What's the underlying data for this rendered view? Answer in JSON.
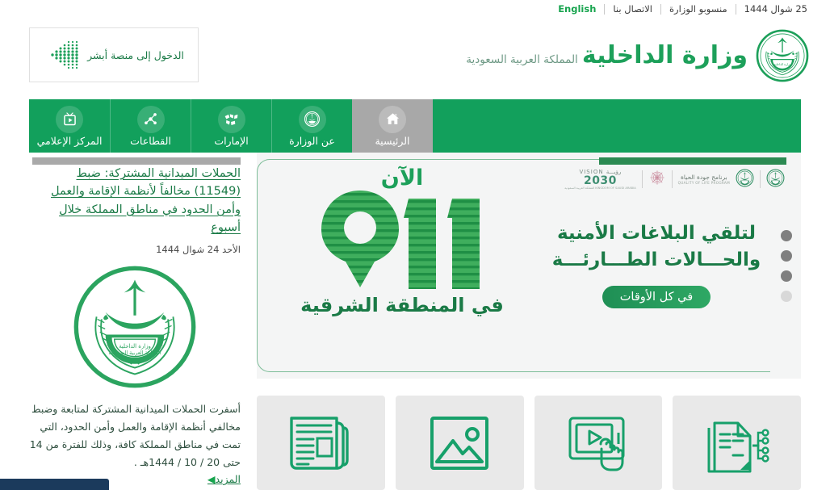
{
  "topbar": {
    "date": "25 شوال 1444",
    "links": [
      {
        "label": "منسوبو الوزارة"
      },
      {
        "label": "الاتصال بنا"
      },
      {
        "label": "English"
      }
    ]
  },
  "header": {
    "absher_button": {
      "label": "الدخول إلى منصة أبشر",
      "icon": "absher-chevron-icon"
    },
    "logo": {
      "title": "وزارة الداخلية",
      "subtitle": "المملكة العربية السعودية",
      "emblem_icon": "moi-emblem-icon"
    }
  },
  "nav": {
    "items": [
      {
        "label": "الرئيسية",
        "icon": "home-icon",
        "active": true
      },
      {
        "label": "عن الوزارة",
        "icon": "ministry-emblem-icon",
        "active": false
      },
      {
        "label": "الإمارات",
        "icon": "regions-icon",
        "active": false
      },
      {
        "label": "القطاعات",
        "icon": "sectors-network-icon",
        "active": false
      },
      {
        "label": "المركز الإعلامي",
        "icon": "media-tv-icon",
        "active": false
      }
    ],
    "active_bg": "#a8a8a8",
    "bar_bg": "#12a05c"
  },
  "news": {
    "title": "الحملات الميدانية المشتركة: ضبط (11549) مخالفاً لأنظمة الإقامة والعمل وأمن الحدود في مناطق المملكة خلال أسبوع",
    "date": "الأحد 24 شوال 1444",
    "image_icon": "moi-emblem-icon",
    "body": "أسفرت الحملات الميدانية المشتركة لمتابعة وضبط مخالفي أنظمة الإقامة والعمل وأمن الحدود، التي تمت في مناطق المملكة كافة، وذلك للفترة من 14 حتى 20 / 10 / 1444هـ .",
    "more_label": "المزيد",
    "more_arrow": "◀"
  },
  "banner": {
    "now_label": "الآن",
    "number": "911",
    "number_icon": "911-pin-icon",
    "region_label": "في المنطقة الشرقية",
    "headline_line1": "لتلقي البلاغات الأمنية",
    "headline_line2": "والحـــالات الطـــارئـــة",
    "pill_label": "في كل الأوقات",
    "logos": [
      {
        "icon": "moi-emblem-small-icon",
        "name": "moi-emblem"
      },
      {
        "icon": "saudi-emblem-small-icon",
        "name": "saudi-emblem"
      },
      {
        "ar": "برنامج جودة الحياة",
        "en": "QUALITY OF LIFE PROGRAM",
        "name": "quality-of-life-program"
      },
      {
        "icon": "vision-rosette-icon",
        "name": "vision-rosette"
      },
      {
        "top": "VISION رؤيـــة",
        "num": "2030",
        "bottom": "المملكة العربية السعودية  KINGDOM OF SAUDI ARABIA",
        "name": "vision-2030"
      }
    ],
    "dots": [
      {
        "active": true
      },
      {
        "active": true
      },
      {
        "active": true
      },
      {
        "active": false
      }
    ],
    "green_accent": "#2b8a52",
    "border_color": "#7dbd98"
  },
  "cards": [
    {
      "name": "open-data-card",
      "icon": "document-data-icon"
    },
    {
      "name": "video-library-card",
      "icon": "video-play-hand-icon"
    },
    {
      "name": "photo-gallery-card",
      "icon": "image-gallery-icon"
    },
    {
      "name": "news-card",
      "icon": "newspaper-icon"
    }
  ],
  "colors": {
    "brand_green": "#1da05a",
    "dark_green": "#1a7a46",
    "nav_green": "#12a05c",
    "active_gray": "#a8a8a8",
    "card_gray": "#e9e9e9",
    "banner_bg": "#f4f5f5",
    "bottom_bar": "#1b3a5c"
  }
}
